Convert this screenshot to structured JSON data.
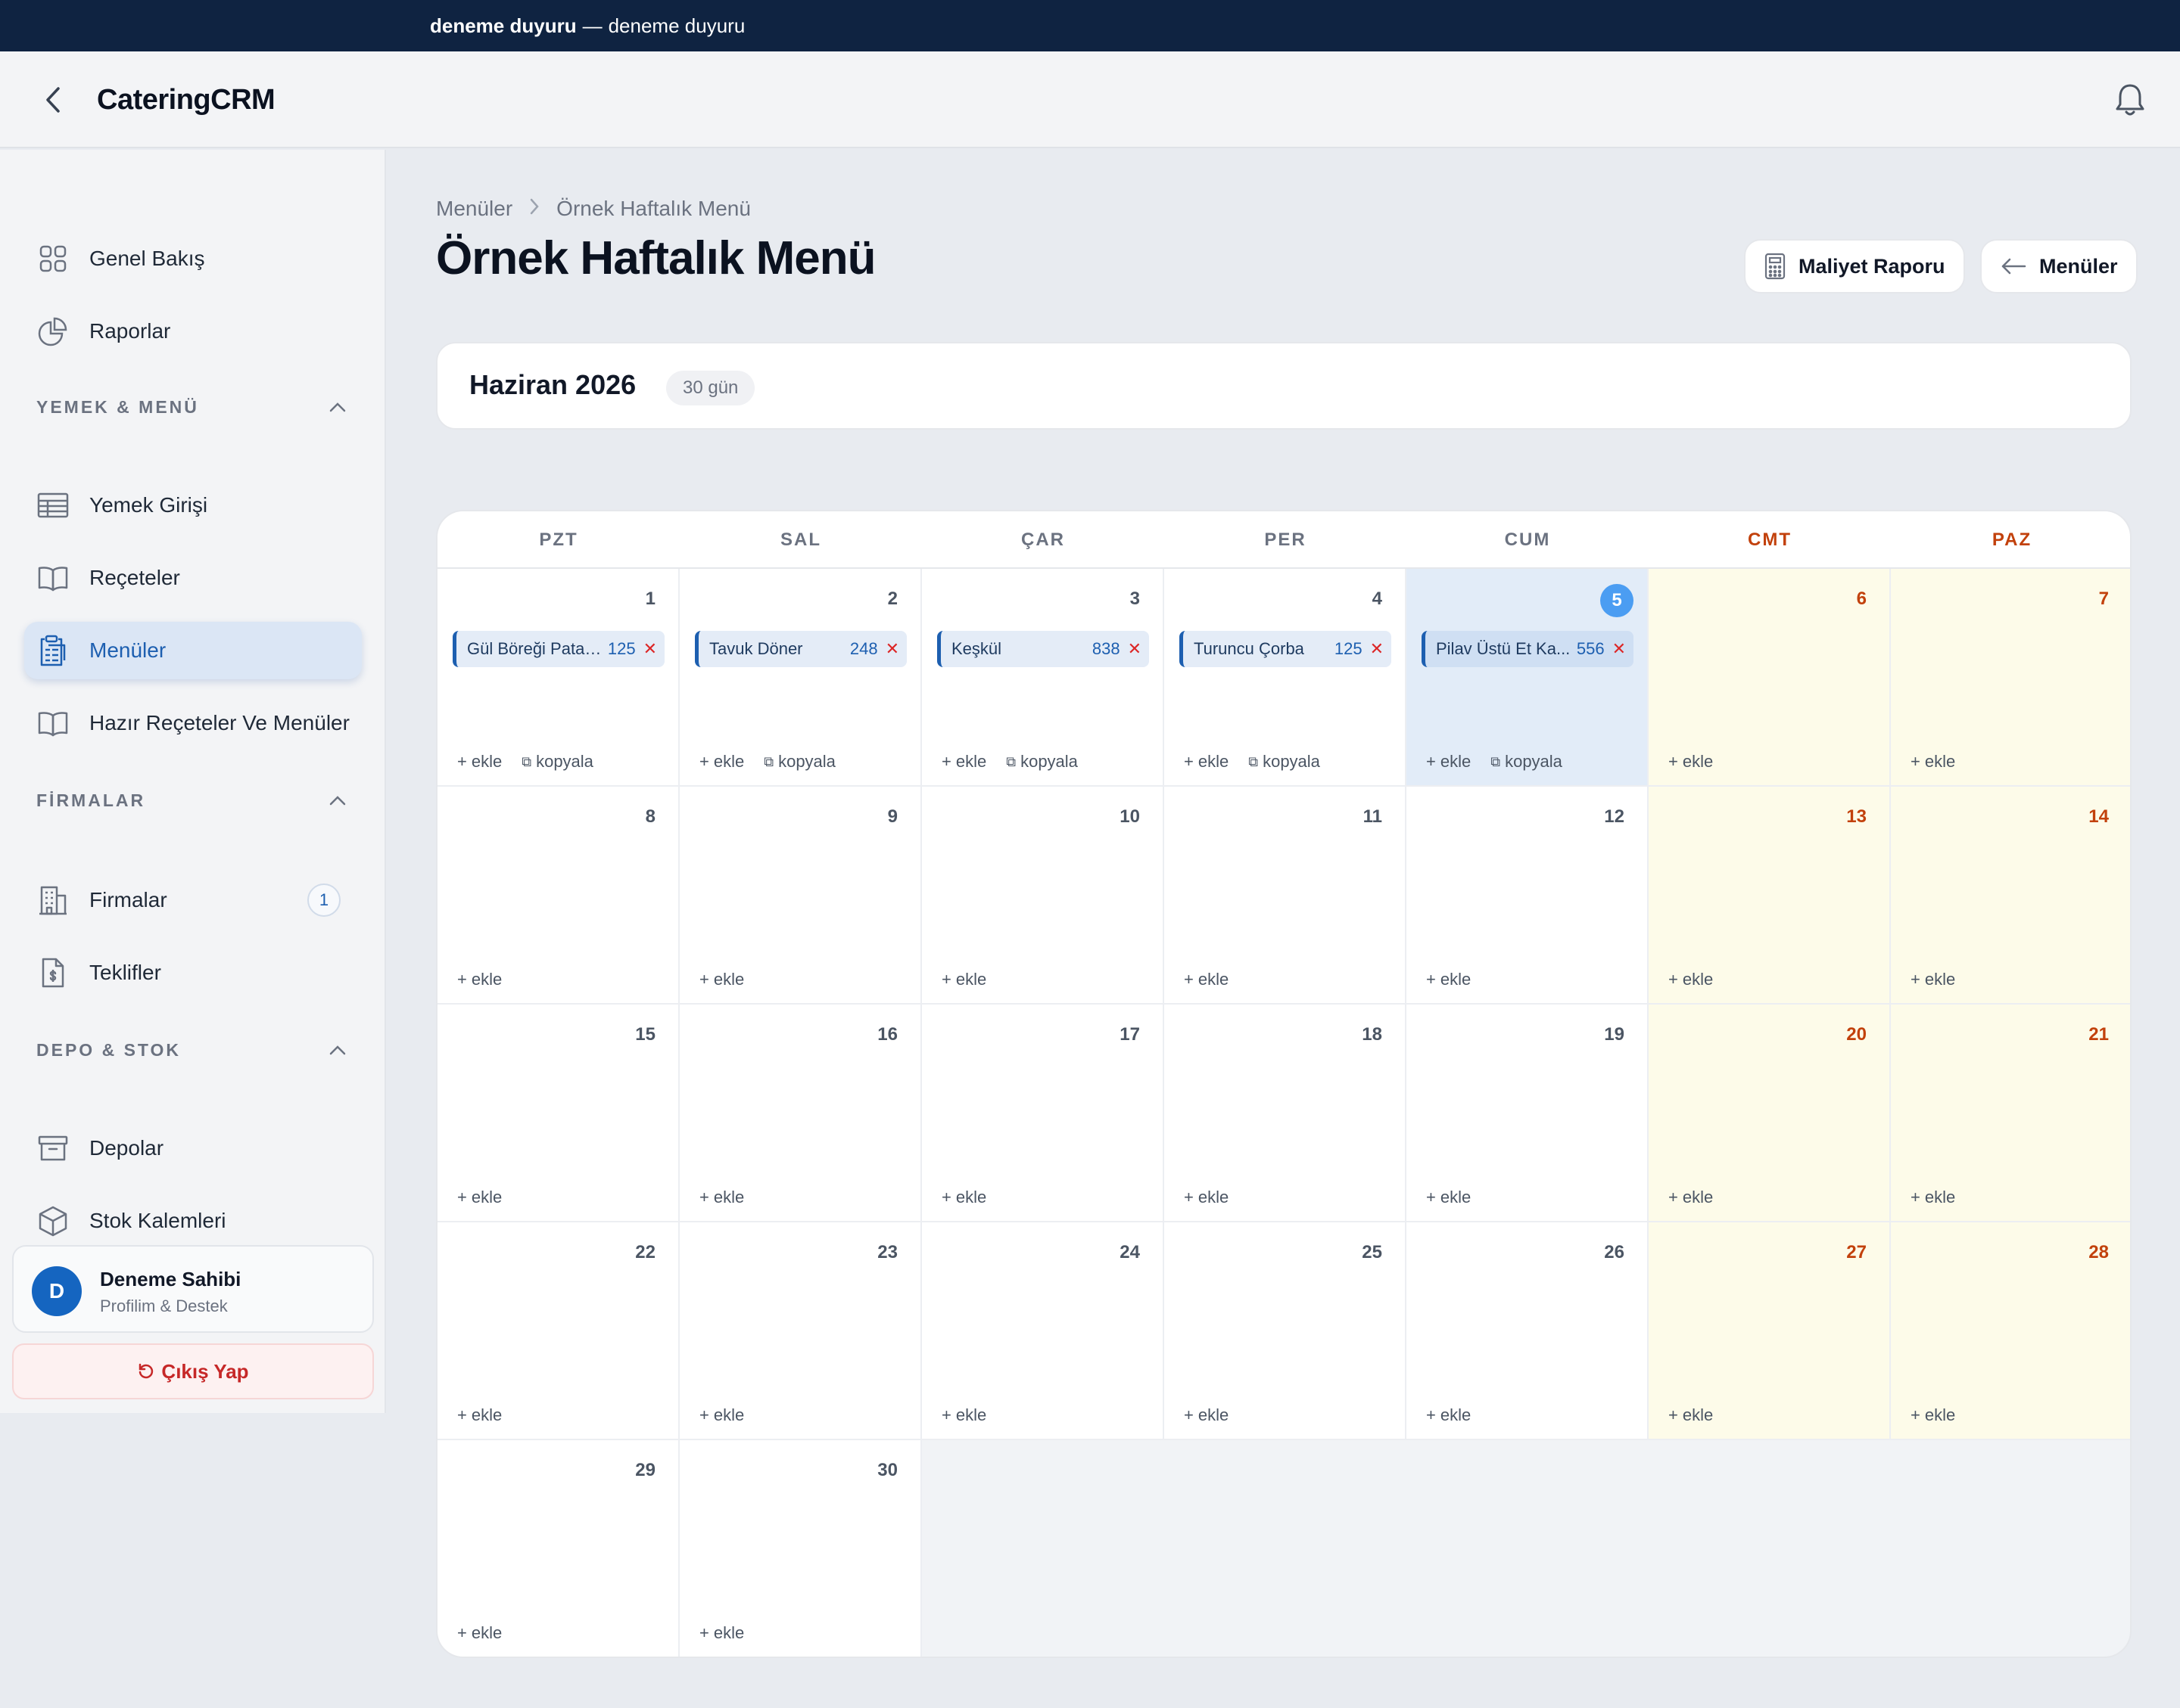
{
  "announcement": {
    "title": "deneme duyuru",
    "separator": "—",
    "text": "deneme duyuru"
  },
  "app": {
    "name": "CateringCRM"
  },
  "sidebar": {
    "top_items": [
      {
        "label": "Genel Bakış",
        "icon": "grid-icon"
      },
      {
        "label": "Raporlar",
        "icon": "pie-chart-icon"
      }
    ],
    "section_food": {
      "title": "YEMEK & MENÜ",
      "items": [
        {
          "label": "Yemek Girişi",
          "icon": "table-icon"
        },
        {
          "label": "Reçeteler",
          "icon": "book-icon"
        },
        {
          "label": "Menüler",
          "icon": "clipboard-icon",
          "active": true
        },
        {
          "label": "Hazır Reçeteler Ve Menüler",
          "icon": "book-icon"
        }
      ]
    },
    "section_firms": {
      "title": "FİRMALAR",
      "items": [
        {
          "label": "Firmalar",
          "icon": "building-icon",
          "badge": "1"
        },
        {
          "label": "Teklifler",
          "icon": "invoice-icon"
        }
      ]
    },
    "section_stock": {
      "title": "DEPO & STOK",
      "items": [
        {
          "label": "Depolar",
          "icon": "archive-icon"
        },
        {
          "label": "Stok Kalemleri",
          "icon": "box-icon"
        }
      ]
    },
    "profile": {
      "initial": "D",
      "name": "Deneme Sahibi",
      "subtitle": "Profilim & Destek"
    },
    "logout_label": "Çıkış Yap"
  },
  "breadcrumb": {
    "parent": "Menüler",
    "current": "Örnek Haftalık Menü"
  },
  "page": {
    "title": "Örnek Haftalık Menü",
    "cost_report_label": "Maliyet Raporu",
    "back_label": "Menüler"
  },
  "month": {
    "title": "Haziran 2026",
    "days_badge": "30 gün"
  },
  "calendar": {
    "weekdays": [
      "PZT",
      "SAL",
      "ÇAR",
      "PER",
      "CUM",
      "CMT",
      "PAZ"
    ],
    "days_in_month": 30,
    "today": 5,
    "add_label": "ekle",
    "copy_label": "kopyala",
    "entries": {
      "1": {
        "name": "Gül Böreği Patat...",
        "value": "125"
      },
      "2": {
        "name": "Tavuk Döner",
        "value": "248"
      },
      "3": {
        "name": "Keşkül",
        "value": "838"
      },
      "4": {
        "name": "Turuncu Çorba",
        "value": "125"
      },
      "5": {
        "name": "Pilav Üstü Et Ka...",
        "value": "556"
      }
    }
  },
  "colors": {
    "accent": "#1d5fb0",
    "weekend": "#c2410c",
    "today": "#4b9df2",
    "topbar": "#0f2341"
  }
}
